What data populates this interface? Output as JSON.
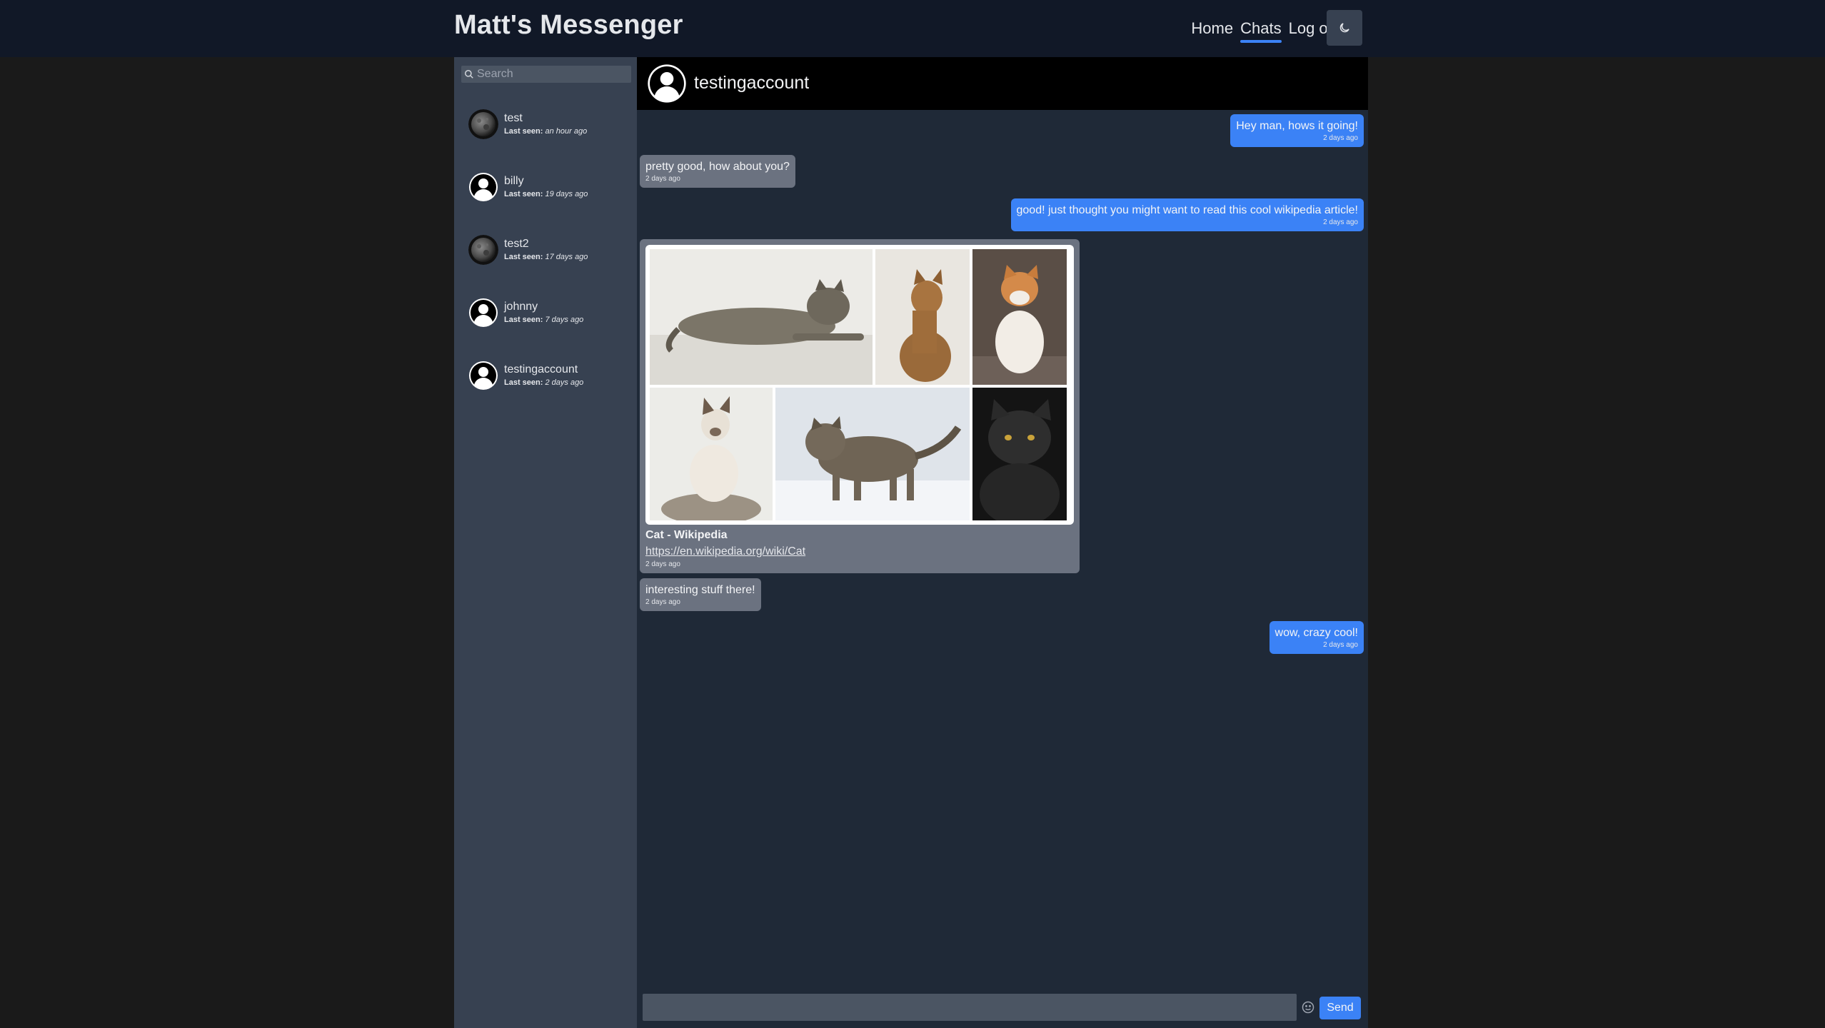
{
  "header": {
    "brand": "Matt's Messenger",
    "nav": {
      "home": "Home",
      "chats": "Chats",
      "logout": "Log out"
    }
  },
  "sidebar": {
    "search_placeholder": "Search",
    "last_seen_label": "Last seen:",
    "contacts": [
      {
        "name": "test",
        "last_seen": "an hour ago",
        "avatar": "moon-avatar"
      },
      {
        "name": "billy",
        "last_seen": "19 days ago",
        "avatar": "default-user-avatar"
      },
      {
        "name": "test2",
        "last_seen": "17 days ago",
        "avatar": "moon-avatar"
      },
      {
        "name": "johnny",
        "last_seen": "7 days ago",
        "avatar": "default-user-avatar"
      },
      {
        "name": "testingaccount",
        "last_seen": "2 days ago",
        "avatar": "default-user-avatar"
      }
    ]
  },
  "chat": {
    "title": "testingaccount",
    "messages": [
      {
        "direction": "out",
        "text": "Hey man, hows it going!",
        "time": "2 days ago"
      },
      {
        "direction": "in",
        "text": "pretty good, how about you?",
        "time": "2 days ago"
      },
      {
        "direction": "out",
        "text": "good! just thought you might want to read this cool wikipedia article!",
        "time": "2 days ago"
      },
      {
        "direction": "in",
        "type": "link",
        "title": "Cat - Wikipedia",
        "url": "https://en.wikipedia.org/wiki/Cat",
        "time": "2 days ago"
      },
      {
        "direction": "in",
        "text": "interesting stuff there!",
        "time": "2 days ago"
      },
      {
        "direction": "out",
        "text": "wow, crazy cool!",
        "time": "2 days ago"
      }
    ],
    "composer": {
      "value": "",
      "send_label": "Send"
    }
  },
  "colors": {
    "accent": "#3b82f6",
    "incoming_bubble": "#6b7280",
    "sidebar": "#374151",
    "chat_bg": "#1f2937",
    "header_bg": "#111827"
  }
}
